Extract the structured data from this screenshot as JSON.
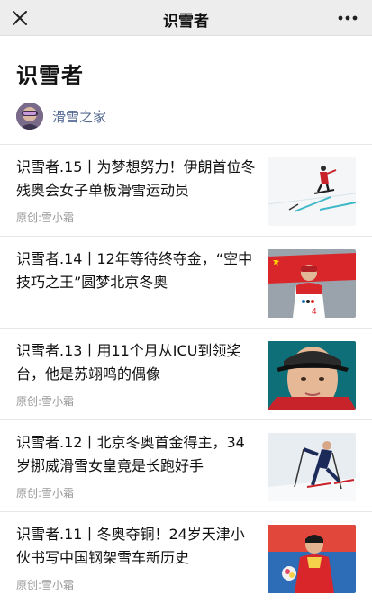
{
  "nav": {
    "title": "识雪者",
    "close_icon": "close-icon",
    "more_icon": "more-dots-icon"
  },
  "page": {
    "title": "识雪者"
  },
  "account": {
    "name": "滑雪之家",
    "avatar_icon": "avatar"
  },
  "articles": [
    {
      "title": "识雪者.15丨为梦想努力！伊朗首位冬残奥会女子单板滑雪运动员",
      "meta": "原创:雪小霜"
    },
    {
      "title": "识雪者.14丨12年等待终夺金，“空中技巧之王”圆梦北京冬奥",
      "meta": ""
    },
    {
      "title": "识雪者.13丨用11个月从ICU到领奖台，他是苏翊鸣的偶像",
      "meta": "原创:雪小霜"
    },
    {
      "title": "识雪者.12丨北京冬奥首金得主，34岁挪威滑雪女皇竟是长跑好手",
      "meta": "原创:雪小霜"
    },
    {
      "title": "识雪者.11丨冬奥夺铜！24岁天津小伙书写中国钢架雪车新历史",
      "meta": "原创:雪小霜"
    }
  ],
  "colors": {
    "nav_bg": "#ededed",
    "link": "#576b95",
    "meta": "#999999"
  }
}
